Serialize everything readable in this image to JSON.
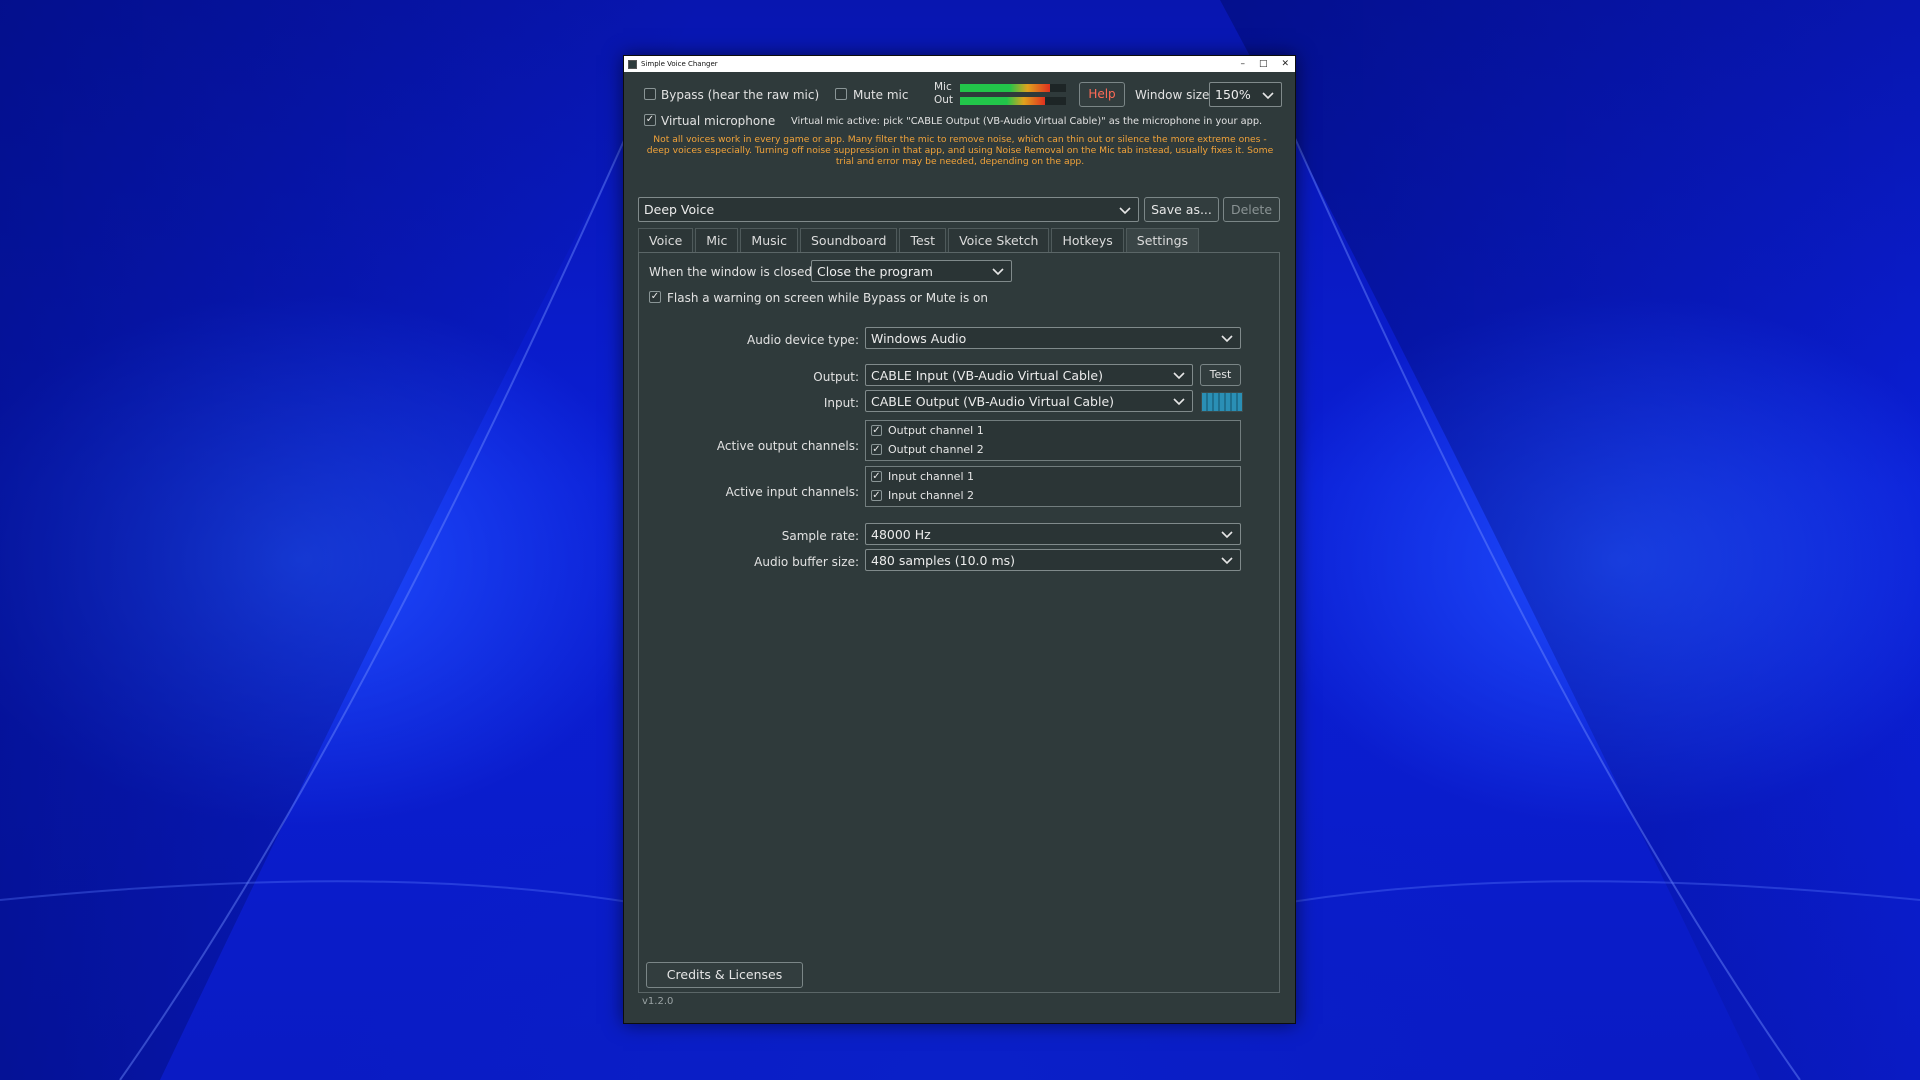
{
  "window": {
    "title": "Simple Voice Changer",
    "controls": {
      "minimize": "–",
      "maximize": "□",
      "close": "✕"
    }
  },
  "top": {
    "bypass_label": "Bypass (hear the raw mic)",
    "bypass_checked": false,
    "mute_label": "Mute mic",
    "mute_checked": false,
    "meter_mic_label": "Mic",
    "meter_out_label": "Out",
    "meter_mic_level": 0.85,
    "meter_out_level": 0.8,
    "help_label": "Help",
    "window_size_label": "Window size:",
    "window_size_value": "150%",
    "virtual_mic_label": "Virtual microphone",
    "virtual_mic_checked": true,
    "virtual_mic_status": "Virtual mic active: pick \"CABLE Output (VB-Audio Virtual Cable)\" as the microphone in your app.",
    "warning_text": "Not all voices work in every game or app. Many filter the mic to remove noise, which can thin out or silence the more extreme ones - deep voices especially. Turning off noise suppression in that app, and using Noise Removal on the Mic tab instead, usually fixes it. Some trial and error may be needed, depending on the app."
  },
  "preset": {
    "value": "Deep Voice",
    "save_as_label": "Save as...",
    "delete_label": "Delete"
  },
  "tabs": [
    "Voice",
    "Mic",
    "Music",
    "Soundboard",
    "Test",
    "Voice Sketch",
    "Hotkeys",
    "Settings"
  ],
  "active_tab": "Settings",
  "settings": {
    "on_close_label": "When the window is closed:",
    "on_close_value": "Close the program",
    "flash_warning_label": "Flash a warning on screen while Bypass or Mute is on",
    "flash_warning_checked": true,
    "device_type_label": "Audio device type:",
    "device_type_value": "Windows Audio",
    "output_label": "Output:",
    "output_value": "CABLE Input (VB-Audio Virtual Cable)",
    "test_label": "Test",
    "input_label": "Input:",
    "input_value": "CABLE Output (VB-Audio Virtual Cable)",
    "active_output_label": "Active output channels:",
    "output_channels": [
      "Output channel 1",
      "Output channel 2"
    ],
    "active_input_label": "Active input channels:",
    "input_channels": [
      "Input channel 1",
      "Input channel 2"
    ],
    "sample_rate_label": "Sample rate:",
    "sample_rate_value": "48000 Hz",
    "buffer_label": "Audio buffer size:",
    "buffer_value": "480 samples (10.0 ms)",
    "credits_label": "Credits & Licenses"
  },
  "version": "v1.2.0",
  "colors": {
    "warning_text": "#f0a23a",
    "help_text": "#ff6b57",
    "meter_green": "#22c54a",
    "meter_red": "#e0301e",
    "input_meter": "#2a8fb5"
  }
}
